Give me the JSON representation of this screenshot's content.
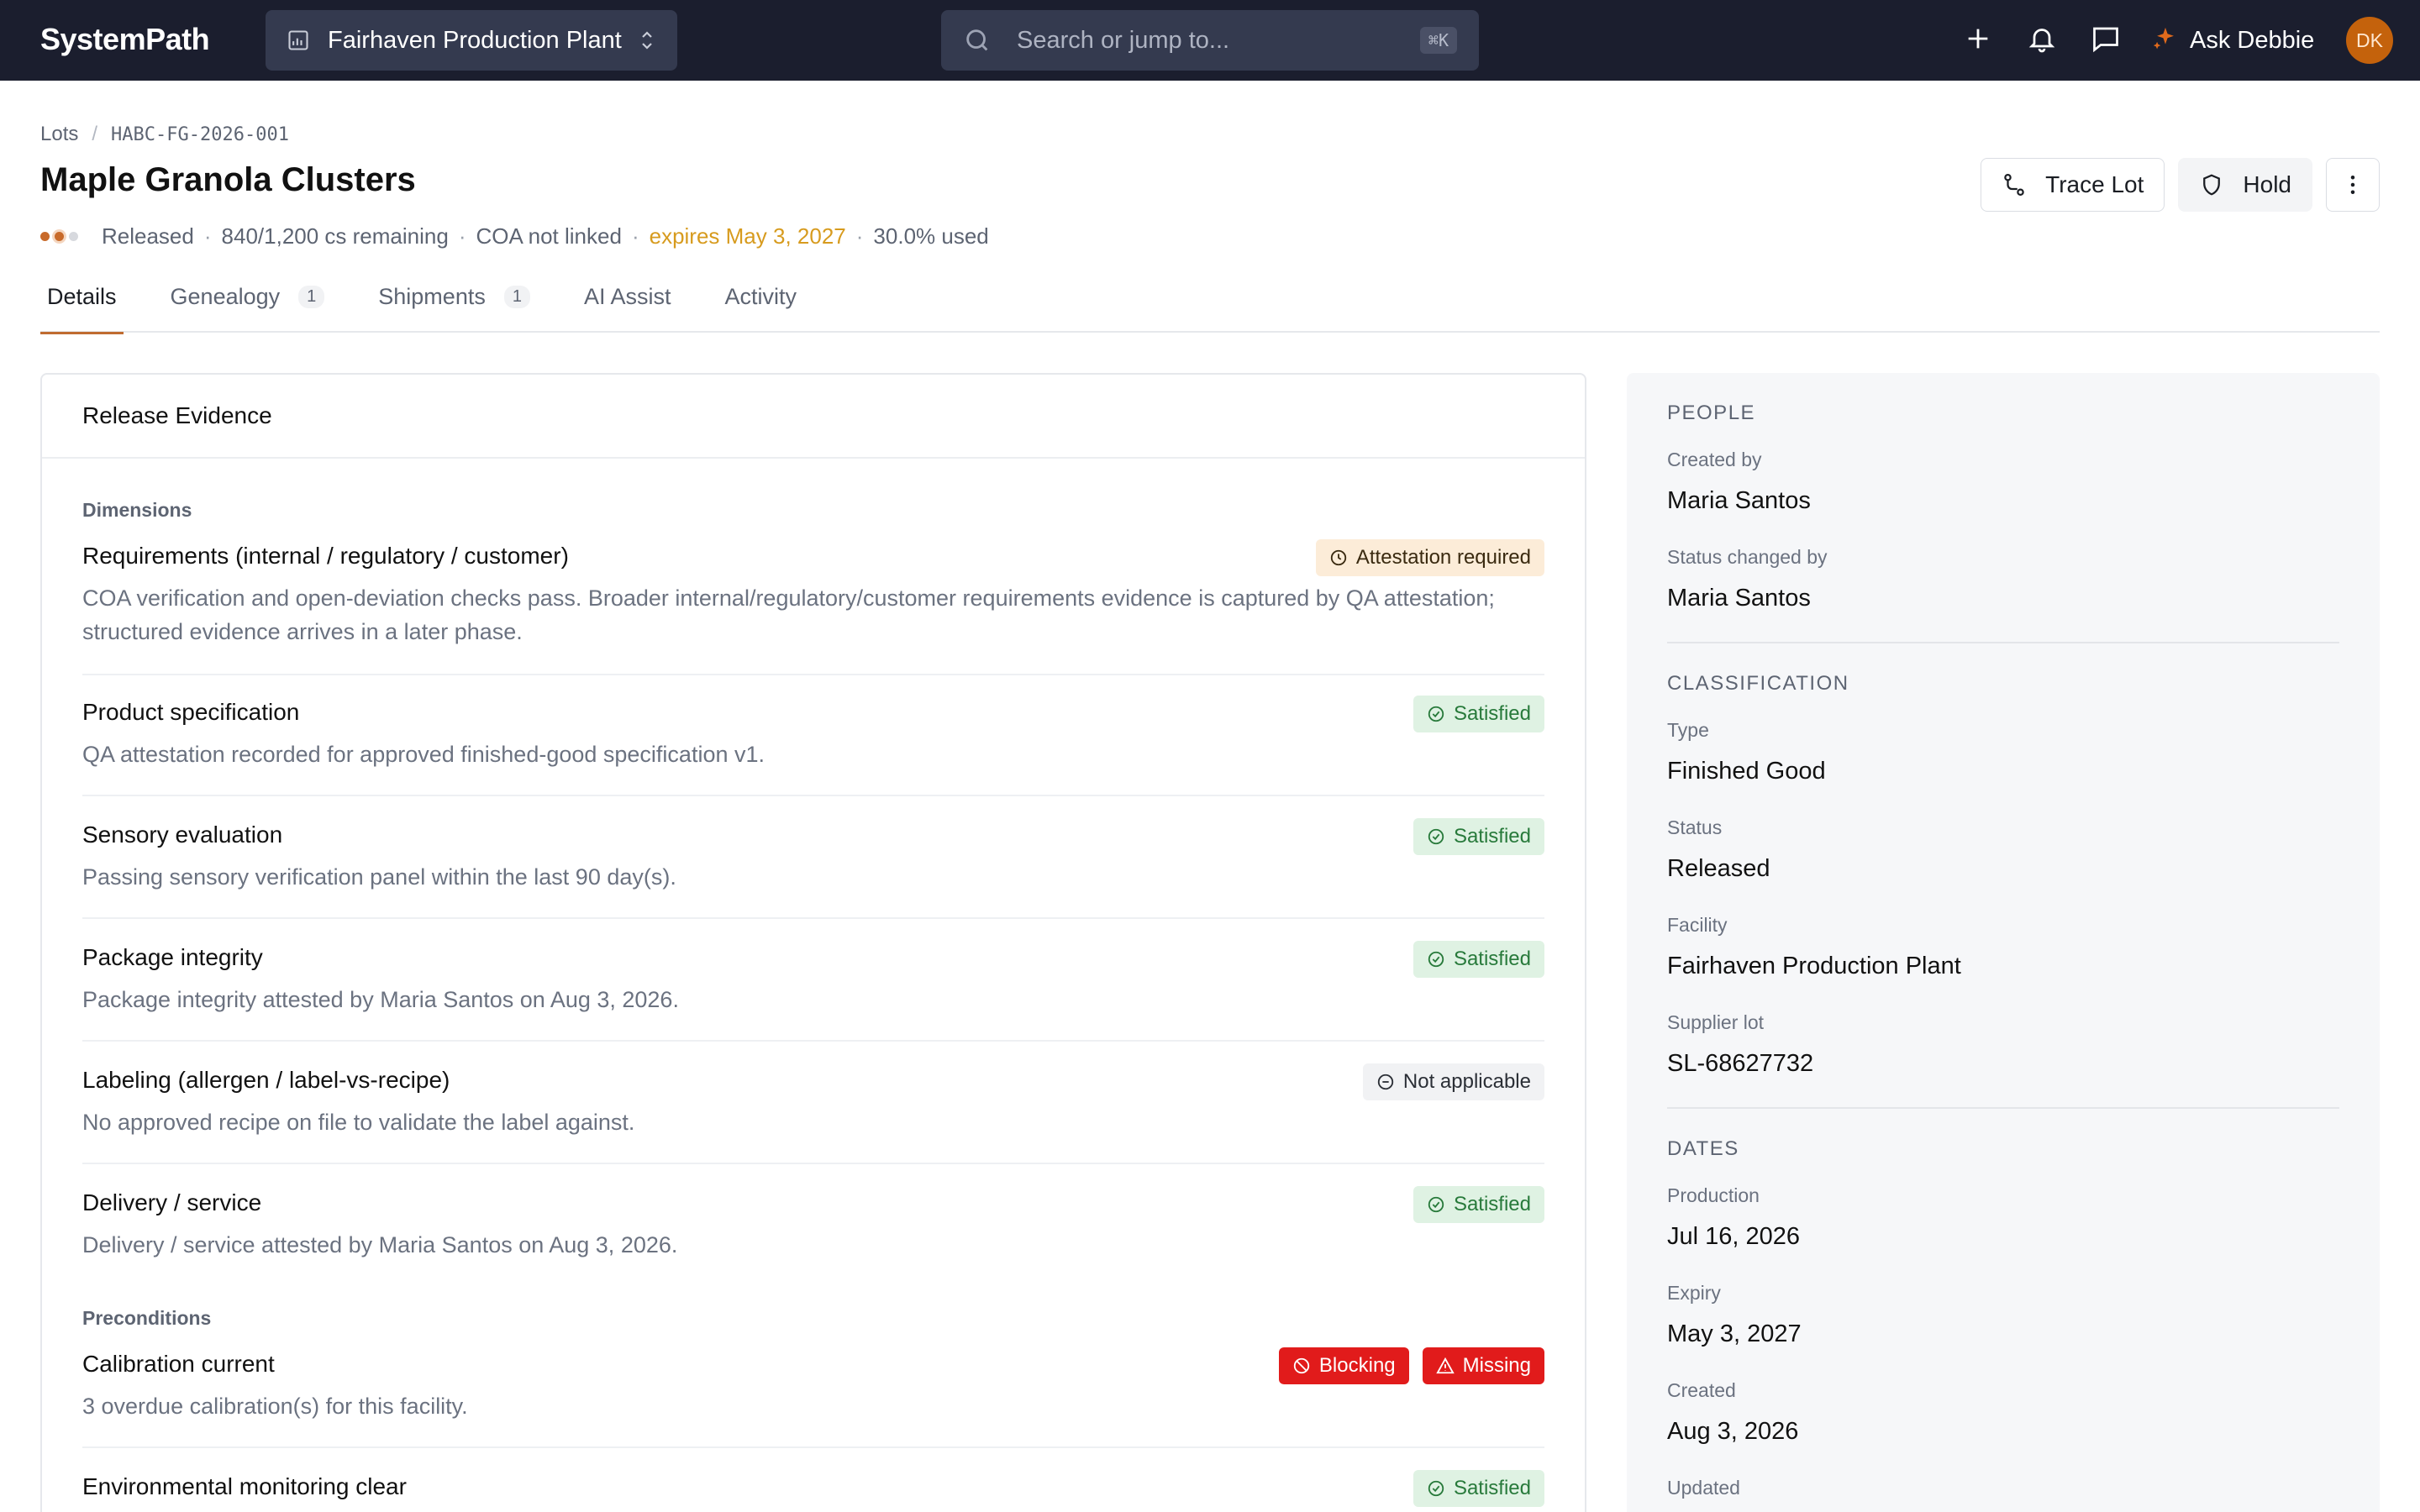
{
  "topbar": {
    "brand": "SystemPath",
    "facility": "Fairhaven Production Plant",
    "search_placeholder": "Search or jump to...",
    "search_shortcut": "⌘K",
    "assistant_label": "Ask Debbie",
    "avatar_initials": "DK"
  },
  "breadcrumb": {
    "root": "Lots",
    "current": "HABC-FG-2026-001"
  },
  "lot": {
    "title": "Maple Granola Clusters",
    "status": "Released",
    "remaining": "840/1,200 cs remaining",
    "coa": "COA not linked",
    "expires": "expires May 3, 2027",
    "used": "30.0% used"
  },
  "actions": {
    "trace": "Trace Lot",
    "hold": "Hold"
  },
  "tabs": [
    {
      "label": "Details",
      "count": ""
    },
    {
      "label": "Genealogy",
      "count": "1"
    },
    {
      "label": "Shipments",
      "count": "1"
    },
    {
      "label": "AI Assist",
      "count": ""
    },
    {
      "label": "Activity",
      "count": ""
    }
  ],
  "evidence": {
    "title": "Release Evidence",
    "dimensions_label": "Dimensions",
    "preconditions_label": "Preconditions",
    "rows": [
      {
        "title": "Requirements (internal / regulatory / customer)",
        "desc": "COA verification and open-deviation checks pass. Broader internal/regulatory/customer requirements evidence is captured by QA attestation; structured evidence arrives in a later phase.",
        "badge": "Attestation required"
      },
      {
        "title": "Product specification",
        "desc": "QA attestation recorded for approved finished-good specification v1.",
        "badge": "Satisfied"
      },
      {
        "title": "Sensory evaluation",
        "desc": "Passing sensory verification panel within the last 90 day(s).",
        "badge": "Satisfied"
      },
      {
        "title": "Package integrity",
        "desc": "Package integrity attested by Maria Santos on Aug 3, 2026.",
        "badge": "Satisfied"
      },
      {
        "title": "Labeling (allergen / label-vs-recipe)",
        "desc": "No approved recipe on file to validate the label against.",
        "badge": "Not applicable"
      },
      {
        "title": "Delivery / service",
        "desc": "Delivery / service attested by Maria Santos on Aug 3, 2026.",
        "badge": "Satisfied"
      },
      {
        "title": "Calibration current",
        "desc": "3 overdue calibration(s) for this facility.",
        "badge": "Blocking",
        "badge2": "Missing"
      },
      {
        "title": "Environmental monitoring clear",
        "desc": "",
        "badge": "Satisfied"
      }
    ]
  },
  "sidebar": {
    "people": "PEOPLE",
    "created_by_label": "Created by",
    "created_by": "Maria Santos",
    "status_changed_label": "Status changed by",
    "status_changed_by": "Maria Santos",
    "classification": "CLASSIFICATION",
    "type_label": "Type",
    "type": "Finished Good",
    "status_label": "Status",
    "status": "Released",
    "facility_label": "Facility",
    "facility": "Fairhaven Production Plant",
    "supplier_lot_label": "Supplier lot",
    "supplier_lot": "SL-68627732",
    "dates": "DATES",
    "production_label": "Production",
    "production": "Jul 16, 2026",
    "expiry_label": "Expiry",
    "expiry": "May 3, 2027",
    "created_label": "Created",
    "created": "Aug 3, 2026",
    "updated_label": "Updated"
  },
  "colors": {
    "topbar": "#1b1e2e",
    "accent": "#c06c30",
    "warning": "#d79b1e",
    "satisfied": "#287a3b",
    "blocking": "#e11b1b"
  },
  "icons": [
    "facility-icon",
    "chevron-updown-icon",
    "search-icon",
    "plus-icon",
    "bell-icon",
    "chat-icon",
    "sparkle-icon",
    "trace-icon",
    "shield-icon",
    "more-vertical-icon",
    "clock-icon",
    "check-circle-icon",
    "minus-circle-icon",
    "ban-icon",
    "alert-triangle-icon"
  ]
}
